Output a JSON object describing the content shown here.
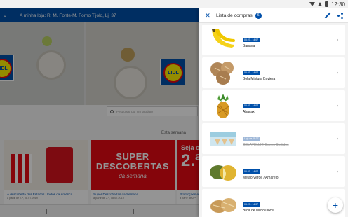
{
  "status_bar": {
    "time": "12:30"
  },
  "background": {
    "store_label": "A minha loja: R. M. Fonte-M. Forno Tijolo, Lj. 37",
    "logo_text": "LIDL",
    "search_placeholder": "Pesquisar por um produto",
    "section_title": "Esta semana",
    "cards": [
      {
        "caption": "A descoberta dos Estados Unidos da América",
        "sub": "a partir de 2.ª, 08.07.2019"
      },
      {
        "big1": "SUPER",
        "big2": "DESCOBERTAS",
        "small": "da semana",
        "caption": "Super Descobertas da Semana",
        "sub": "a partir de 2.ª, 08.07.2019"
      },
      {
        "line1": "Seja o",
        "line2": "2.ª",
        "caption": "Promoções e",
        "sub": "a partir de 2.ª"
      }
    ]
  },
  "drawer": {
    "title": "Lista de compras",
    "count": "6",
    "items": [
      {
        "date": "08.07 - 14.07",
        "name": "Banana",
        "done": false
      },
      {
        "date": "08.07 - 14.07",
        "name": "Bola Mistura Baviera",
        "done": false
      },
      {
        "date": "08.07 - 14.07",
        "name": "Abacaxi",
        "done": false
      },
      {
        "date": "Loja de 08.07",
        "name": "GELATELLI® Cones Sortidos",
        "done": true
      },
      {
        "date": "08.07 - 14.07",
        "name": "Melão Verde / Amarelo",
        "done": false
      },
      {
        "date": "08.07 - 14.07",
        "name": "Broa de Milho Doce",
        "done": false
      }
    ]
  },
  "colors": {
    "brand_blue": "#0050aa",
    "brand_red": "#e60a14",
    "brand_yellow": "#fff200"
  }
}
